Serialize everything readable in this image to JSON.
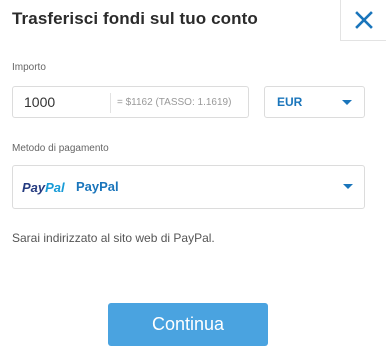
{
  "header": {
    "title": "Trasferisci fondi sul tuo conto",
    "close_icon": "close-x-icon"
  },
  "amount": {
    "label": "Importo",
    "value": "1000",
    "conversion": "= $1162   (TASSO: 1.1619)"
  },
  "currency": {
    "selected": "EUR",
    "caret_icon": "chevron-down-icon"
  },
  "payment_method": {
    "label": "Metodo di pagamento",
    "logo_pay": "Pay",
    "logo_pal": "Pal",
    "selected": "PayPal",
    "caret_icon": "chevron-down-icon"
  },
  "info_text": "Sarai indirizzato al sito web di PayPal.",
  "continue_label": "Continua",
  "colors": {
    "accent": "#1a75bb",
    "button": "#4aa3e0",
    "paypal_dark": "#253b80",
    "paypal_light": "#179bd7"
  }
}
